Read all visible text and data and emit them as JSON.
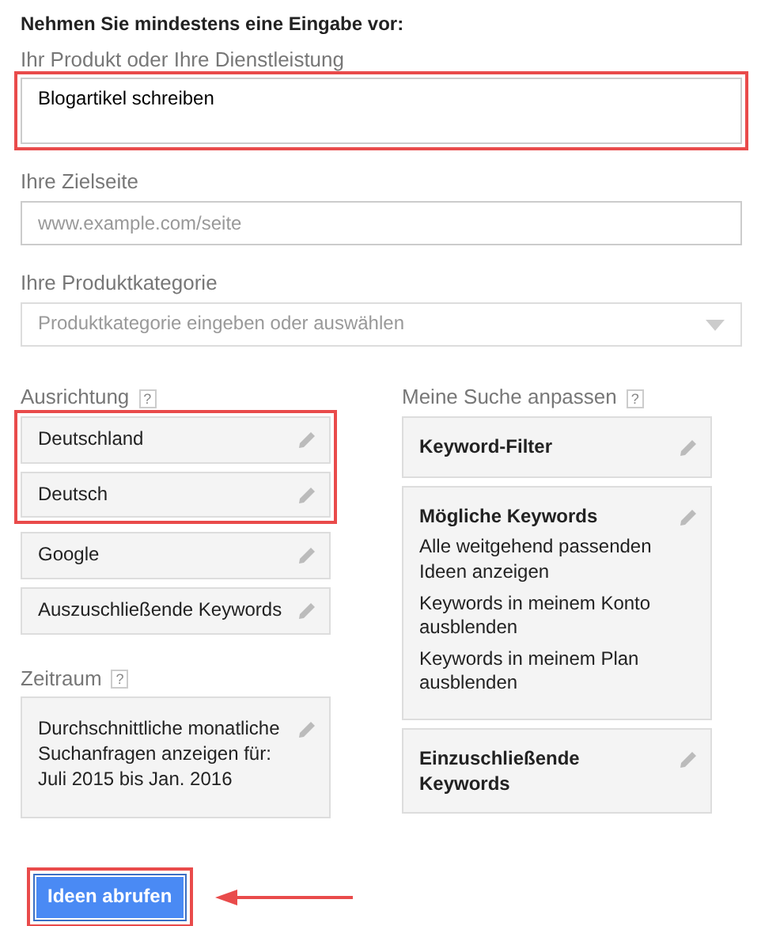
{
  "heading": "Nehmen Sie mindestens eine Eingabe vor:",
  "product": {
    "label": "Ihr Produkt oder Ihre Dienstleistung",
    "value": "Blogartikel schreiben",
    "highlighted": true
  },
  "landing_page": {
    "label": "Ihre Zielseite",
    "placeholder": "www.example.com/seite"
  },
  "category": {
    "label": "Ihre Produktkategorie",
    "placeholder": "Produktkategorie eingeben oder auswählen"
  },
  "targeting": {
    "label": "Ausrichtung",
    "help": "?",
    "groups": [
      {
        "highlighted": true,
        "items": [
          "Deutschland",
          "Deutsch"
        ]
      },
      {
        "highlighted": false,
        "items": [
          "Google",
          "Auszuschließende Keywords"
        ]
      }
    ]
  },
  "date_range": {
    "label": "Zeitraum",
    "help": "?",
    "text": "Durchschnittliche monatliche Suchanfragen anzeigen für: Juli 2015 bis Jan. 2016"
  },
  "customize": {
    "label": "Meine Suche anpassen",
    "help": "?",
    "cards": [
      {
        "title": "Keyword-Filter"
      },
      {
        "title": "Mögliche Keywords",
        "lines": [
          "Alle weitgehend passenden Ideen anzeigen",
          "Keywords in meinem Konto ausblenden",
          "Keywords in meinem Plan ausblenden"
        ]
      },
      {
        "title": "Einzuschließende Keywords"
      }
    ]
  },
  "submit": {
    "label": "Ideen abrufen",
    "highlighted": true,
    "arrow": true
  }
}
